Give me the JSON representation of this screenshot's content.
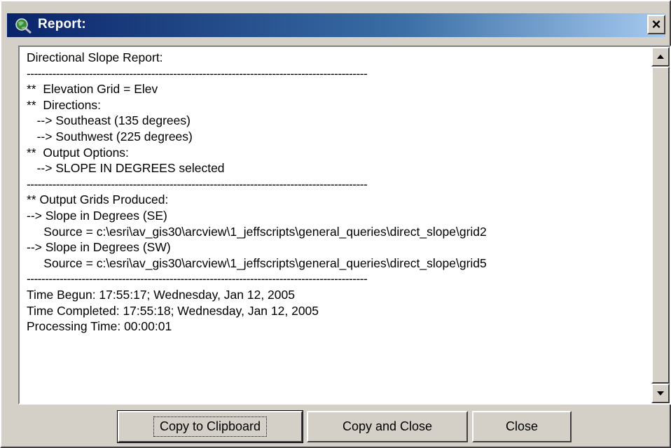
{
  "window": {
    "title": "Report:",
    "close_glyph": "×",
    "icon": "globe-magnifier-icon"
  },
  "report": {
    "lines": [
      "Directional Slope Report:",
      "---------------------------------------------------------------------------------------------",
      "**  Elevation Grid = Elev",
      "**  Directions:",
      "   --> Southeast (135 degrees)",
      "   --> Southwest (225 degrees)",
      "**  Output Options:",
      "   --> SLOPE IN DEGREES selected",
      "---------------------------------------------------------------------------------------------",
      "** Output Grids Produced:",
      "--> Slope in Degrees (SE)",
      "     Source = c:\\esri\\av_gis30\\arcview\\1_jeffscripts\\general_queries\\direct_slope\\grid2",
      "--> Slope in Degrees (SW)",
      "     Source = c:\\esri\\av_gis30\\arcview\\1_jeffscripts\\general_queries\\direct_slope\\grid5",
      "---------------------------------------------------------------------------------------------",
      "Time Begun: 17:55:17; Wednesday, Jan 12, 2005",
      "Time Completed: 17:55:18; Wednesday, Jan 12, 2005",
      "Processing Time: 00:00:01"
    ]
  },
  "buttons": {
    "copy_clipboard": "Copy to Clipboard",
    "copy_close": "Copy and Close",
    "close": "Close"
  },
  "colors": {
    "titlebar_start": "#0a246a",
    "titlebar_end": "#a6caf0",
    "face": "#d4d0c8"
  }
}
